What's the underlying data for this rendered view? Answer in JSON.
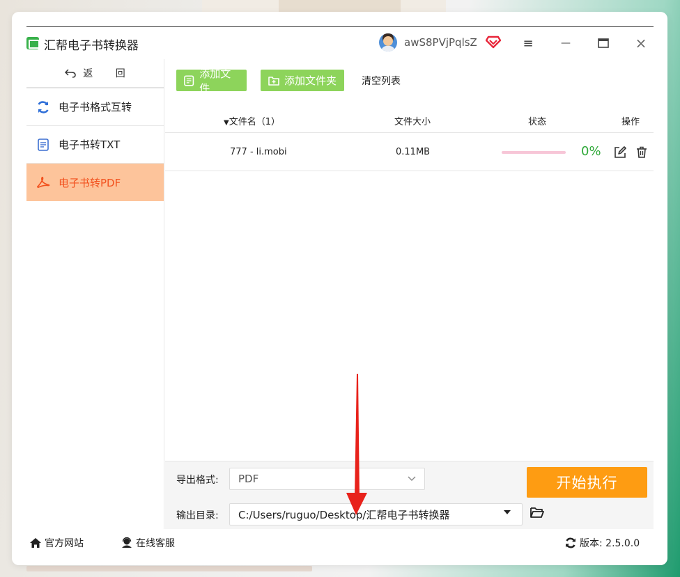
{
  "app": {
    "title": "汇帮电子书转换器",
    "username": "awS8PVjPqlsZ"
  },
  "window_controls": {
    "menu": "≡",
    "minimize": "—",
    "maximize": "▭",
    "close": "×"
  },
  "sidebar": {
    "back_label": "返 回",
    "items": [
      {
        "label": "电子书格式互转",
        "icon": "refresh-icon",
        "active": false
      },
      {
        "label": "电子书转TXT",
        "icon": "document-icon",
        "active": false
      },
      {
        "label": "电子书转PDF",
        "icon": "pdf-icon",
        "active": true
      }
    ]
  },
  "toolbar": {
    "add_file": "添加文件",
    "add_folder": "添加文件夹",
    "clear_list": "清空列表"
  },
  "table": {
    "headers": {
      "name": "文件名（1）",
      "size": "文件大小",
      "status": "状态",
      "actions": "操作"
    },
    "rows": [
      {
        "name": "777 - li.mobi",
        "size": "0.11MB",
        "progress": 0,
        "progress_text": "0%"
      }
    ]
  },
  "bottom": {
    "format_label": "导出格式:",
    "format_value": "PDF",
    "dir_label": "输出目录:",
    "dir_value": "C:/Users/ruguo/Desktop/汇帮电子书转换器",
    "start_label": "开始执行"
  },
  "statusbar": {
    "website": "官方网站",
    "support": "在线客服",
    "version": "版本: 2.5.0.0"
  },
  "colors": {
    "accent_green": "#8dd45b",
    "active_nav_bg": "#fdc49b",
    "active_nav_text": "#f2521f",
    "start_button": "#fe9c12",
    "progress_track": "#f7c6d7",
    "percent_text": "#2ea838",
    "annotation_arrow": "#e8221b"
  }
}
